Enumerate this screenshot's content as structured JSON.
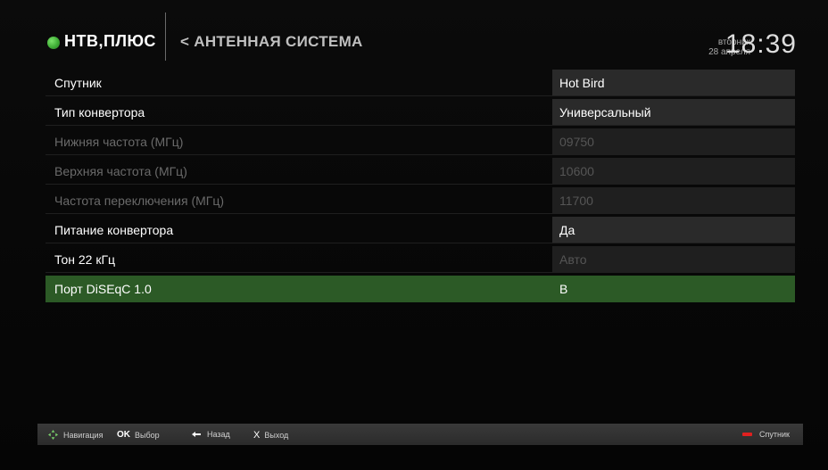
{
  "header": {
    "logo": "НТВ,ПЛЮС",
    "breadcrumb": "< АНТЕННАЯ СИСТЕМА",
    "weekday": "вторник",
    "date": "28 апреля",
    "time": "18:39"
  },
  "colors": {
    "accent": "#2c5a26",
    "logo_green": "#3fae36",
    "red_key": "#e0201f"
  },
  "settings": [
    {
      "label": "Спутник",
      "value": "Hot Bird"
    },
    {
      "label": "Тип конвертора",
      "value": "Универсальный"
    },
    {
      "label": "Нижняя частота (МГц)",
      "value": "09750"
    },
    {
      "label": "Верхняя частота (МГц)",
      "value": "10600"
    },
    {
      "label": "Частота переключения (МГц)",
      "value": "11700"
    },
    {
      "label": "Питание конвертора",
      "value": "Да"
    },
    {
      "label": "Тон 22 кГц",
      "value": "Авто"
    },
    {
      "label": "Порт DiSEqC 1.0",
      "value": "B"
    }
  ],
  "footer": {
    "navigation": "Навигация",
    "ok_key": "OK",
    "select": "Выбор",
    "back": "Назад",
    "x_key": "X",
    "exit": "Выход",
    "satellite": "Спутник"
  },
  "icons": {
    "logo": "green-dot-icon",
    "navigation": "dpad-icon",
    "back": "back-arrow-icon",
    "red_button": "red-key-icon"
  }
}
